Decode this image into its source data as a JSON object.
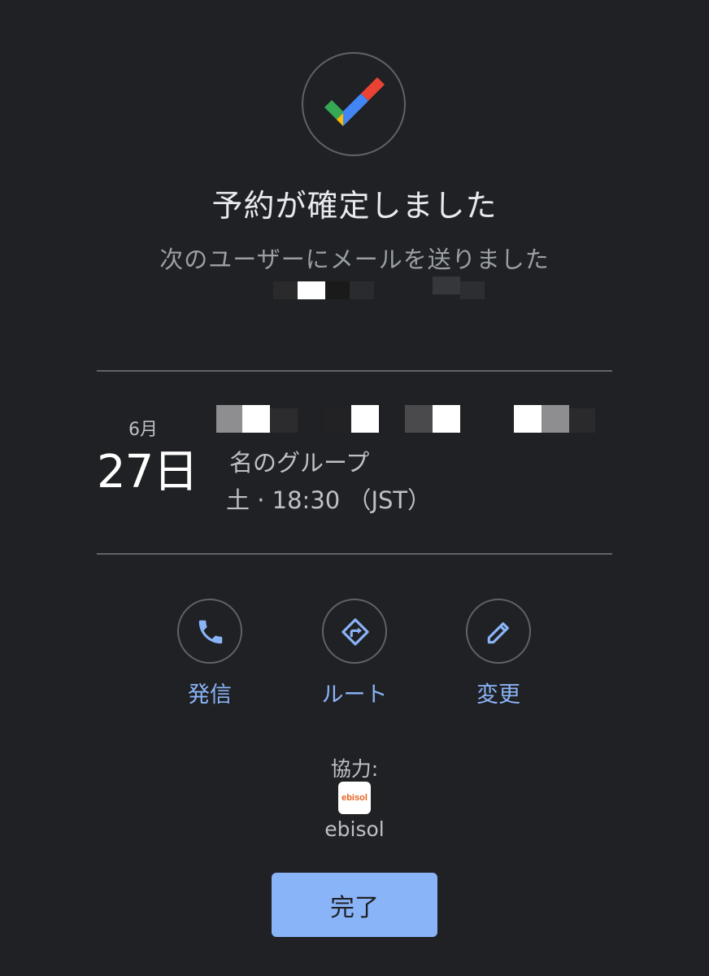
{
  "confirmation": {
    "title": "予約が確定しました",
    "subtitle": "次のユーザーにメールを送りました"
  },
  "booking": {
    "month": "6月",
    "day": "27日",
    "party": "名のグループ",
    "time": "土 · 18:30 （JST）"
  },
  "actions": [
    {
      "label": "発信",
      "icon": "phone-icon"
    },
    {
      "label": "ルート",
      "icon": "directions-icon"
    },
    {
      "label": "変更",
      "icon": "edit-pencil-icon"
    }
  ],
  "partner": {
    "powered_by": "協力:",
    "logo_text": "ebisol",
    "name": "ebisol"
  },
  "done_label": "完了",
  "colors": {
    "background": "#202124",
    "accent": "#8ab4f8",
    "divider": "#5f6368",
    "google_red": "#ea4335",
    "google_blue": "#4285f4",
    "google_green": "#34a853",
    "google_yellow": "#fbbc04"
  }
}
